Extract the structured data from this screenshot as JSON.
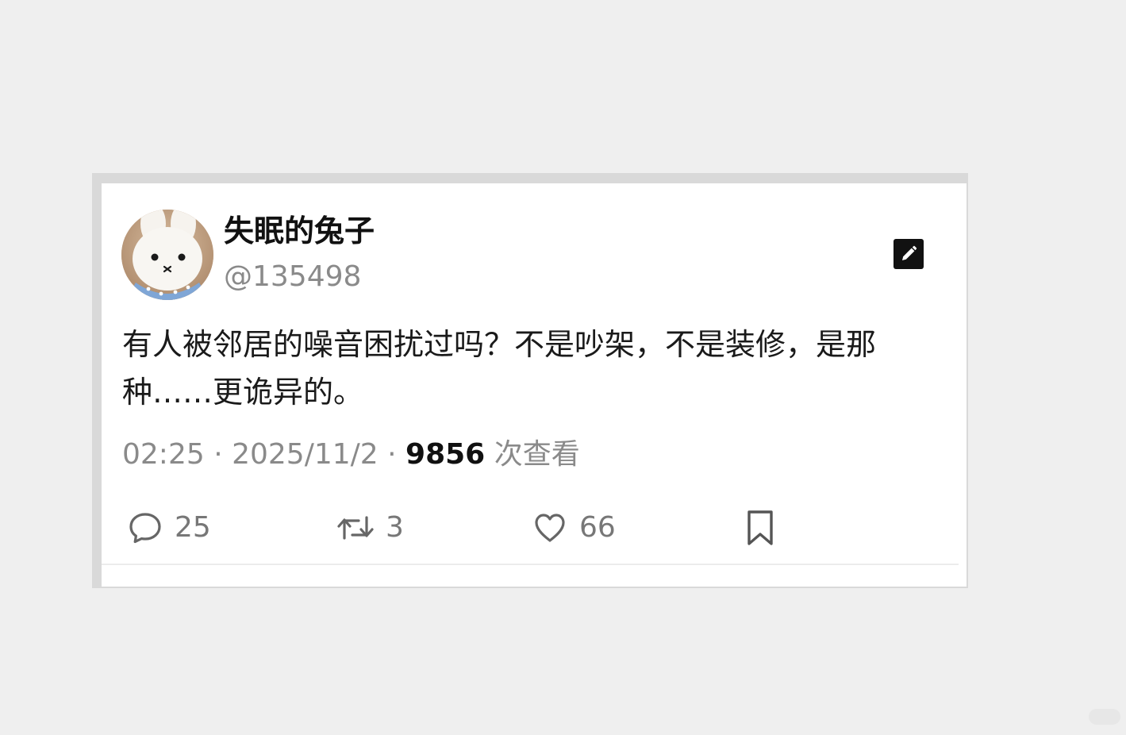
{
  "post": {
    "author_name": "失眠的兔子",
    "author_handle": "@135498",
    "text": "有人被邻居的噪音困扰过吗？不是吵架，不是装修，是那种……更诡异的。",
    "time": "02:25",
    "date": "2025/11/2",
    "views_count": "9856",
    "views_label": "次查看"
  },
  "actions": {
    "replies": "25",
    "reposts": "3",
    "likes": "66"
  },
  "icons": {
    "edit": "pencil-icon",
    "reply": "speech-bubble-icon",
    "repost": "repost-arrows-icon",
    "like": "heart-icon",
    "bookmark": "bookmark-icon"
  },
  "colors": {
    "background": "#efefef",
    "card": "#ffffff",
    "primary_text": "#1a1a1a",
    "muted_text": "#8a8a8a",
    "accent_dark": "#111111"
  }
}
